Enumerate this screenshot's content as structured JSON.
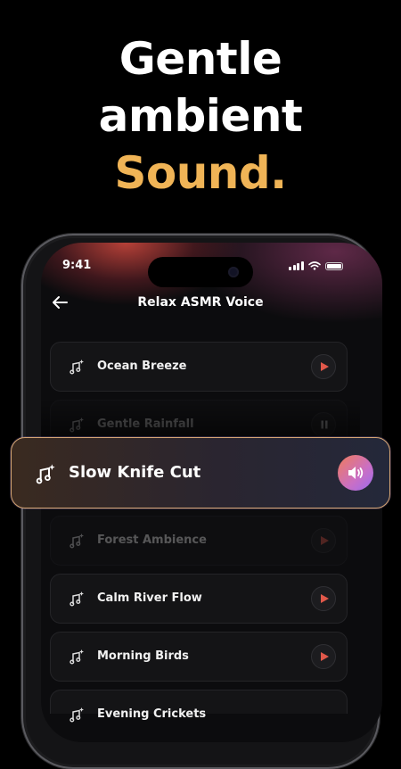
{
  "headline": {
    "line1": "Gentle",
    "line2": "ambient",
    "line3": "Sound."
  },
  "status_bar": {
    "time": "9:41"
  },
  "screen": {
    "title": "Relax ASMR Voice"
  },
  "tracks": [
    {
      "label": "Ocean Breeze"
    },
    {
      "label": "Gentle Rainfall"
    },
    {
      "label": "Slow Knife Cut"
    },
    {
      "label": "Forest Ambience"
    },
    {
      "label": "Calm River Flow"
    },
    {
      "label": "Morning Birds"
    },
    {
      "label": "Evening Crickets"
    }
  ],
  "colors": {
    "accent": "#f0b456",
    "play_icon": "#e0584a",
    "card_border": "#d7a774"
  },
  "icons": {
    "track": "music-sparkle-icon",
    "play": "play-icon",
    "pause": "pause-icon",
    "speaker": "speaker-icon",
    "back": "back-arrow-icon"
  }
}
